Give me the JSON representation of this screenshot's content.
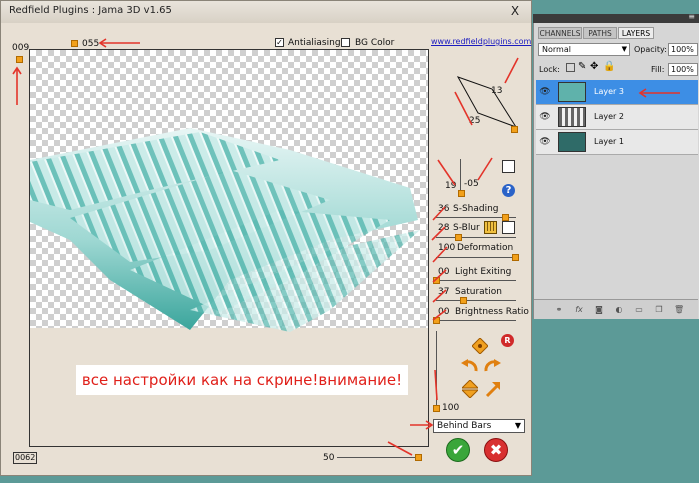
{
  "plugin": {
    "title": "Redfield Plugins : Jama 3D  v1.65",
    "close": "X",
    "top_left_value": "009",
    "top_value": "055",
    "antialiasing_label": "Antialiasing",
    "antialiasing_checked": true,
    "bg_color_label": "BG Color",
    "bg_color_checked": false,
    "link": "www.redfieldplugins.com",
    "angle_top": "13",
    "angle_bottom": "25",
    "v1": "19",
    "v2": "-05",
    "help": "?",
    "sliders": [
      {
        "value": "36",
        "label": "S-Shading"
      },
      {
        "value": "28",
        "label": "S-Blur"
      },
      {
        "value": "100",
        "label": "Deformation"
      },
      {
        "value": "00",
        "label": "Light Exiting"
      },
      {
        "value": "37",
        "label": "Saturation"
      },
      {
        "value": "00",
        "label": "Brightness Ratio"
      }
    ],
    "reset_badge": "R",
    "vertical_value": "100",
    "dropdown_value": "Behind Bars",
    "bottom_left_value": "0062",
    "bottom_value": "50",
    "warning": "все настройки как на скрине!внимание!"
  },
  "layers_panel": {
    "tabs": [
      "CHANNELS",
      "PATHS",
      "LAYERS"
    ],
    "blend_mode": "Normal",
    "opacity_label": "Opacity:",
    "opacity_value": "100%",
    "lock_label": "Lock:",
    "fill_label": "Fill:",
    "fill_value": "100%",
    "layers": [
      {
        "name": "Layer 3",
        "selected": true
      },
      {
        "name": "Layer 2",
        "selected": false
      },
      {
        "name": "Layer 1",
        "selected": false
      }
    ]
  },
  "colors": {
    "accent": "#3d8ee5",
    "warning_text": "#e0201a",
    "knob": "#f2a01a",
    "background": "#5c9a97"
  }
}
